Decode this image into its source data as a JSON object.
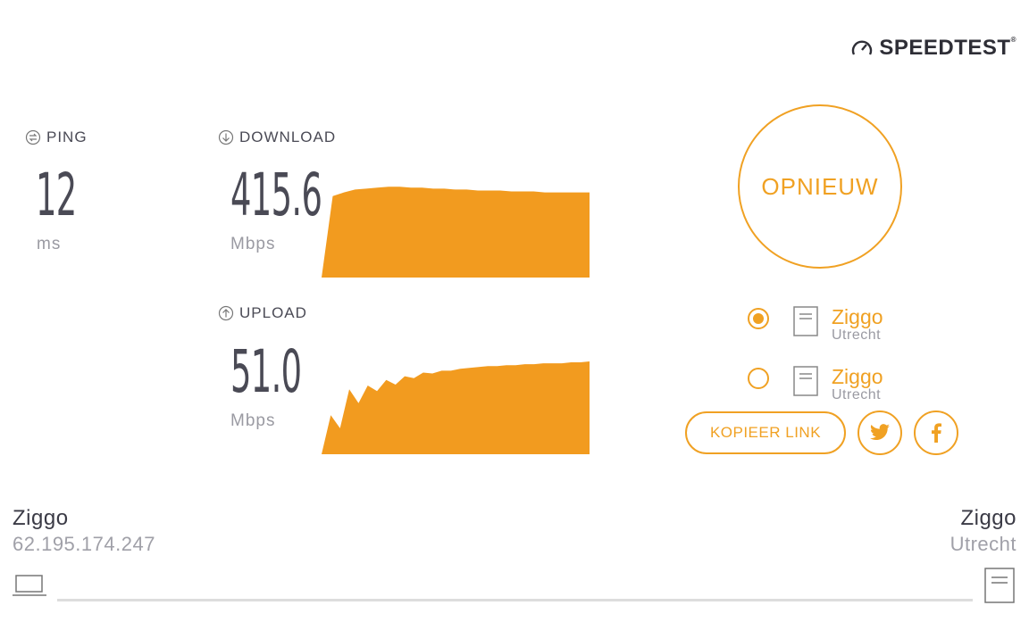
{
  "brand": {
    "name": "SPEEDTEST",
    "tm": "®"
  },
  "metrics": {
    "ping": {
      "label": "PING",
      "value": "12",
      "unit": "ms"
    },
    "download": {
      "label": "DOWNLOAD",
      "value": "415.6",
      "unit": "Mbps"
    },
    "upload": {
      "label": "UPLOAD",
      "value": "51.0",
      "unit": "Mbps"
    }
  },
  "action": {
    "again_label": "OPNIEUW"
  },
  "servers": [
    {
      "name": "Ziggo",
      "location": "Utrecht",
      "selected": true
    },
    {
      "name": "Ziggo",
      "location": "Utrecht",
      "selected": false
    }
  ],
  "share": {
    "copy_link_label": "KOPIEER LINK",
    "icons": [
      "twitter-icon",
      "facebook-icon"
    ]
  },
  "client": {
    "isp": "Ziggo",
    "ip": "62.195.174.247"
  },
  "server": {
    "name": "Ziggo",
    "location": "Utrecht"
  },
  "colors": {
    "accent": "#f0a123",
    "text": "#3a3a45",
    "muted": "#9a9aa2"
  },
  "chart_data": [
    {
      "type": "area",
      "series": [
        {
          "values": [
            0,
            0.86,
            0.9,
            0.93,
            0.94,
            0.95,
            0.96,
            0.96,
            0.95,
            0.95,
            0.94,
            0.94,
            0.93,
            0.93,
            0.92,
            0.92,
            0.92,
            0.91,
            0.91,
            0.91,
            0.9,
            0.9,
            0.9,
            0.9,
            0.9
          ]
        }
      ]
    },
    {
      "type": "area",
      "series": [
        {
          "values": [
            0,
            0.42,
            0.28,
            0.7,
            0.55,
            0.74,
            0.68,
            0.8,
            0.75,
            0.84,
            0.82,
            0.88,
            0.87,
            0.9,
            0.9,
            0.92,
            0.93,
            0.94,
            0.95,
            0.95,
            0.96,
            0.96,
            0.97,
            0.97,
            0.98,
            0.98,
            0.98,
            0.99,
            0.99,
            1.0
          ]
        }
      ]
    }
  ]
}
